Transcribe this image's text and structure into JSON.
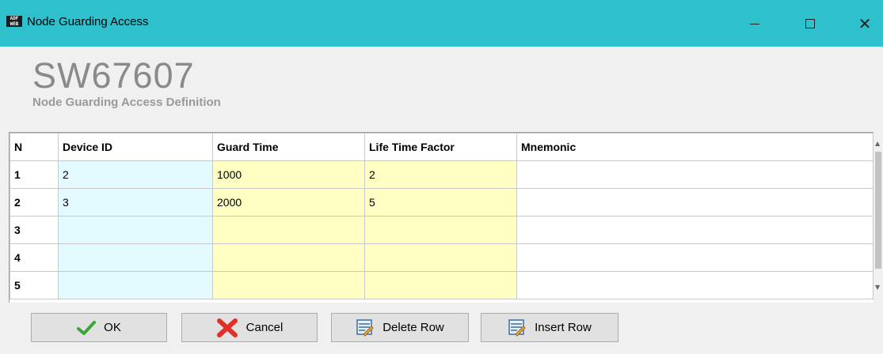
{
  "window": {
    "title": "Node Guarding Access",
    "icon_text": "ADF WEB",
    "close_glyph": "✕"
  },
  "header": {
    "title": "SW67607",
    "subtitle": "Node Guarding Access Definition"
  },
  "grid": {
    "columns": [
      "N",
      "Device ID",
      "Guard Time",
      "Life Time Factor",
      "Mnemonic"
    ],
    "rows": [
      {
        "n": "1",
        "device_id": "2",
        "guard_time": "1000",
        "life_time_factor": "2",
        "mnemonic": ""
      },
      {
        "n": "2",
        "device_id": "3",
        "guard_time": "2000",
        "life_time_factor": "5",
        "mnemonic": ""
      },
      {
        "n": "3",
        "device_id": "",
        "guard_time": "",
        "life_time_factor": "",
        "mnemonic": ""
      },
      {
        "n": "4",
        "device_id": "",
        "guard_time": "",
        "life_time_factor": "",
        "mnemonic": ""
      },
      {
        "n": "5",
        "device_id": "",
        "guard_time": "",
        "life_time_factor": "",
        "mnemonic": ""
      }
    ]
  },
  "buttons": {
    "ok": "OK",
    "cancel": "Cancel",
    "delete_row": "Delete Row",
    "insert_row": "Insert Row"
  },
  "colors": {
    "titlebar": "#2ec0cc",
    "device_cell": "#e3fbff",
    "editable_cell": "#ffffc4"
  }
}
